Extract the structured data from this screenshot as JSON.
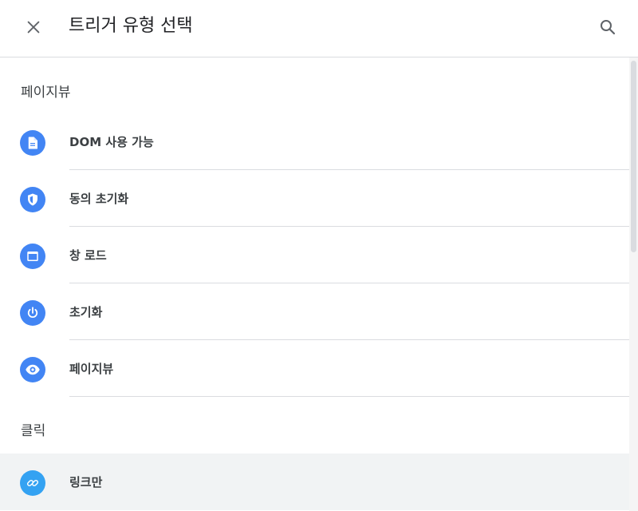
{
  "header": {
    "title": "트리거 유형 선택",
    "close_icon": "close-icon",
    "search_icon": "search-icon"
  },
  "sections": [
    {
      "title": "페이지뷰",
      "items": [
        {
          "label": "DOM 사용 가능",
          "icon": "document-icon"
        },
        {
          "label": "동의 초기화",
          "icon": "shield-icon"
        },
        {
          "label": "창 로드",
          "icon": "window-icon"
        },
        {
          "label": "초기화",
          "icon": "power-icon"
        },
        {
          "label": "페이지뷰",
          "icon": "eye-icon"
        }
      ]
    },
    {
      "title": "클릭",
      "items": [
        {
          "label": "링크만",
          "icon": "link-icon"
        }
      ]
    }
  ],
  "colors": {
    "accent": "#4285f4",
    "link_accent": "#34a2f2",
    "highlight": "#f1f3f4",
    "divider": "#dadce0"
  }
}
